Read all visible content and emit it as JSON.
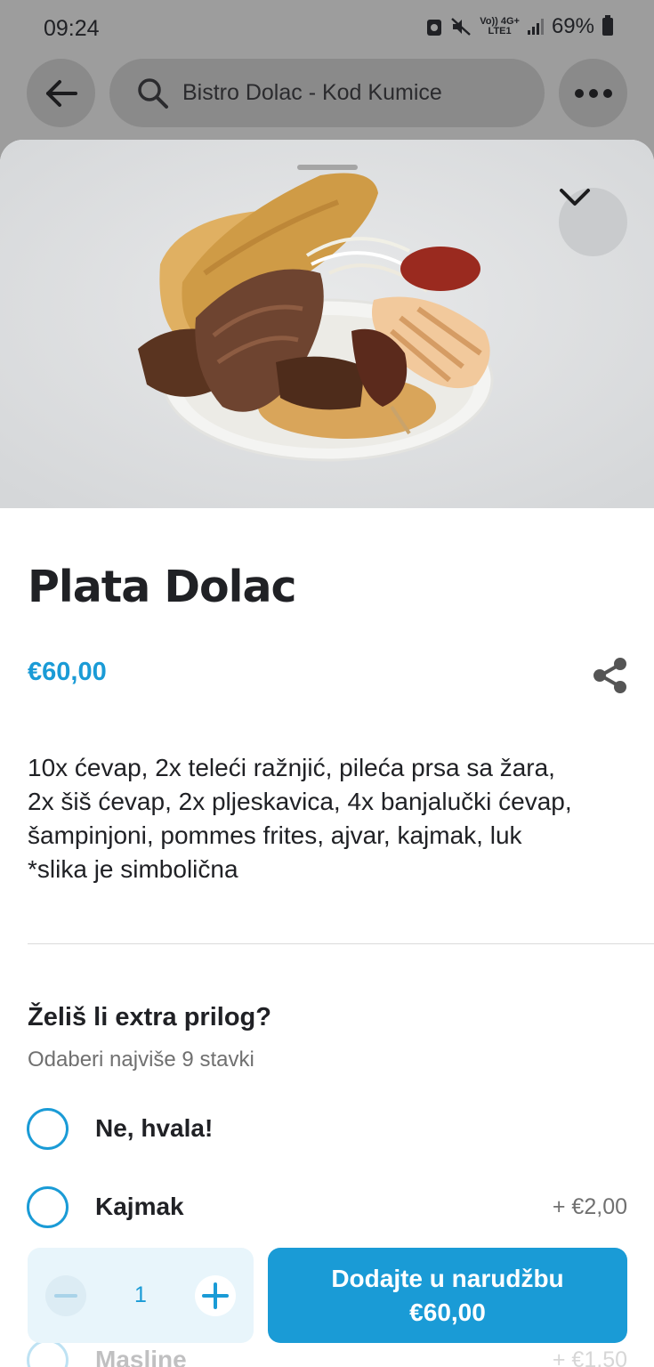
{
  "status_bar": {
    "time": "09:24",
    "network_top": "Vo)) 4G+",
    "network_bottom": "LTE1",
    "battery": "69%"
  },
  "header": {
    "search_text": "Bistro Dolac - Kod Kumice",
    "icons": [
      "arrow-left-icon",
      "search-icon",
      "more-icon"
    ]
  },
  "item": {
    "title": "Plata Dolac",
    "price": "€60,00",
    "description_lines": [
      "10x ćevap, 2x teleći ražnjić, pileća prsa sa žara,",
      "2x šiš ćevap, 2x pljeskavica, 4x banjalučki ćevap,",
      "šampinjoni, pommes frites, ajvar, kajmak, luk",
      "*slika je simbolična"
    ]
  },
  "options": {
    "heading": "Želiš li extra prilog?",
    "subheading": "Odaberi najviše 9 stavki",
    "items": [
      {
        "label": "Ne, hvala!",
        "price": ""
      },
      {
        "label": "Kajmak",
        "price": "+ €2,00"
      },
      {
        "label": "Masline",
        "price": "+ €1,50"
      }
    ]
  },
  "cart": {
    "quantity": "1",
    "add_label": "Dodajte u narudžbu",
    "add_price": "€60,00"
  },
  "colors": {
    "accent": "#1a9bd6",
    "text": "#202125",
    "muted": "#707070"
  }
}
